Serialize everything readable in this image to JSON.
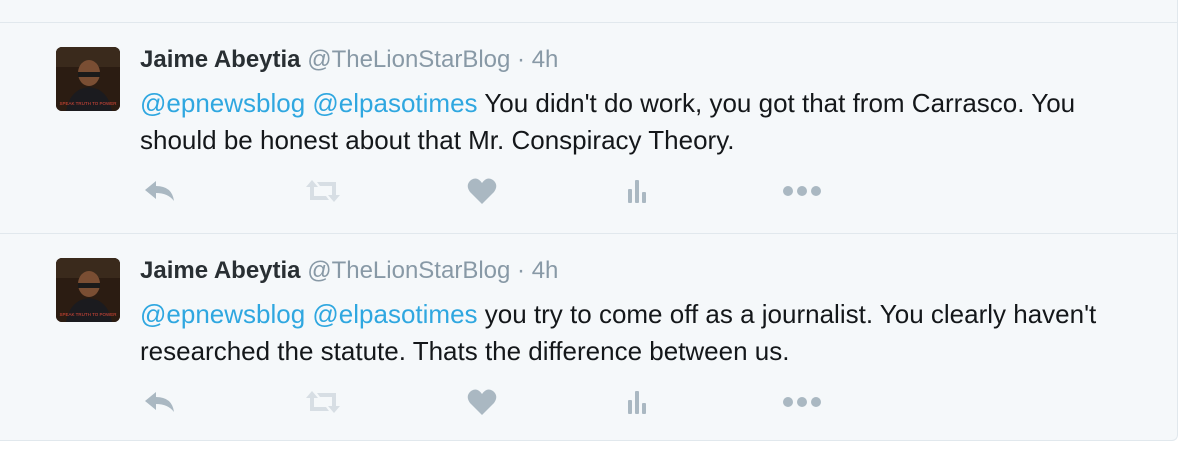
{
  "colors": {
    "background": "#f5f8fa",
    "name": "#292f33",
    "meta": "#8899a6",
    "text": "#14171a",
    "mention": "#2fa7e0",
    "icon": "#aab8c2",
    "divider": "#e1e8ed"
  },
  "tweets": [
    {
      "author_name": "Jaime Abeytia",
      "handle": "@TheLionStarBlog",
      "separator": "·",
      "time": "4h",
      "mentions": [
        "@epnewsblog",
        "@elpasotimes"
      ],
      "body": "You didn't do work, you got that from Carrasco. You should be honest about that Mr. Conspiracy Theory.",
      "avatar_caption": "SPEAK TRUTH TO POWER",
      "actions": [
        "reply-icon",
        "retweet-icon",
        "heart-icon",
        "analytics-icon",
        "more-icon"
      ]
    },
    {
      "author_name": "Jaime Abeytia",
      "handle": "@TheLionStarBlog",
      "separator": "·",
      "time": "4h",
      "mentions": [
        "@epnewsblog",
        "@elpasotimes"
      ],
      "body": "you try to come off as a journalist. You clearly haven't researched the statute. Thats the difference between us.",
      "avatar_caption": "SPEAK TRUTH TO POWER",
      "actions": [
        "reply-icon",
        "retweet-icon",
        "heart-icon",
        "analytics-icon",
        "more-icon"
      ]
    }
  ]
}
